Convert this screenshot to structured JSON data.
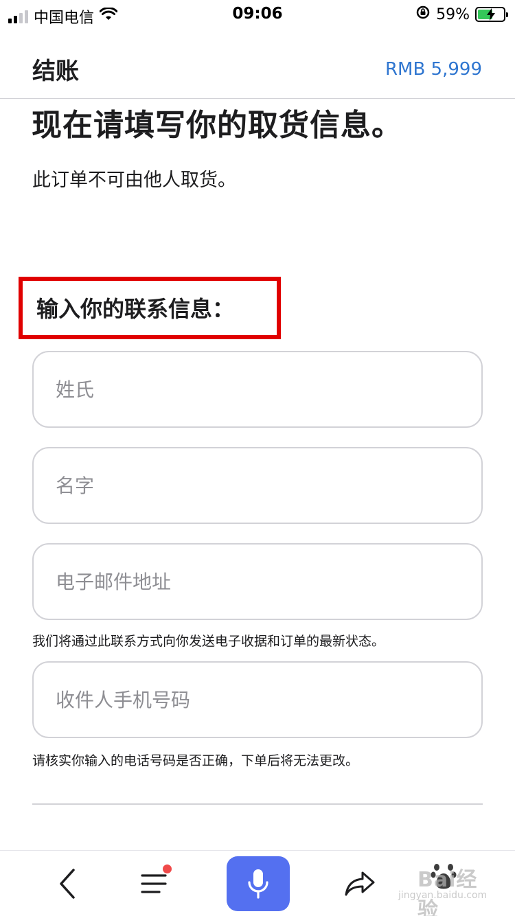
{
  "status_bar": {
    "carrier": "中国电信",
    "time": "09:06",
    "battery_percent": "59%",
    "battery_level": 0.59
  },
  "header": {
    "title": "结账",
    "price": "RMB 5,999"
  },
  "main": {
    "headline": "现在请填写你的取货信息。",
    "subtext": "此订单不可由他人取货。",
    "section_title": "输入你的联系信息：",
    "fields": {
      "last_name_placeholder": "姓氏",
      "first_name_placeholder": "名字",
      "email_placeholder": "电子邮件地址",
      "phone_placeholder": "收件人手机号码"
    },
    "email_hint": "我们将通过此联系方式向你发送电子收据和订单的最新状态。",
    "phone_hint": "请核实你输入的电话号码是否正确，下单后将无法更改。"
  },
  "toolbar": {
    "icons": [
      "back-icon",
      "menu-icon",
      "microphone-icon",
      "share-icon"
    ]
  },
  "watermark": {
    "text": "Bai经验",
    "sub": "jingyan.baidu.com"
  },
  "colors": {
    "accent_blue": "#2f76d0",
    "highlight_red": "#e00000",
    "mic_button": "#5470f0",
    "notification_dot": "#f04a4a"
  }
}
